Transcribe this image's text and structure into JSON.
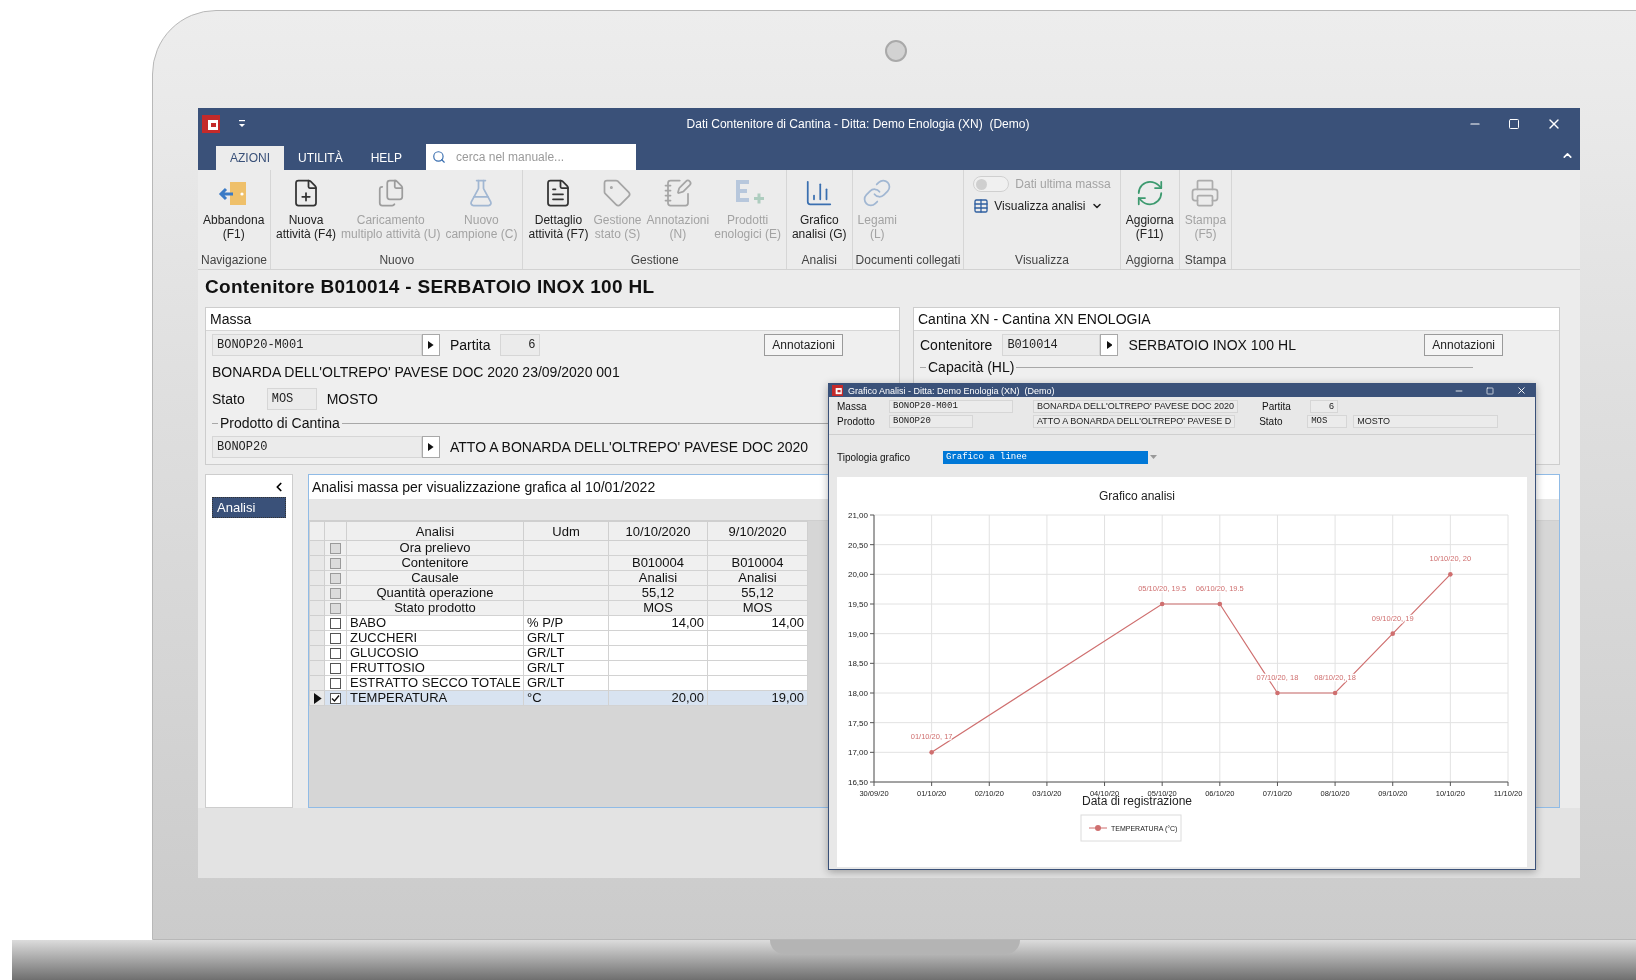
{
  "window": {
    "title": "Dati Contenitore di Cantina - Ditta: Demo Enologia (XN)  (Demo)"
  },
  "ribbon": {
    "tabs": [
      {
        "label": "AZIONI",
        "selected": true
      },
      {
        "label": "UTILITÀ",
        "selected": false
      },
      {
        "label": "HELP",
        "selected": false
      }
    ],
    "search": {
      "placeholder": "cerca nel manuale..."
    },
    "groups": [
      {
        "label": "Navigazione",
        "items": [
          {
            "kind": "large",
            "lines": [
              "Abbandona",
              "(F1)"
            ],
            "disabled": false
          }
        ]
      },
      {
        "label": "Nuovo",
        "items": [
          {
            "kind": "large",
            "lines": [
              "Nuova",
              "attività (F4)"
            ],
            "disabled": false
          },
          {
            "kind": "large",
            "lines": [
              "Caricamento",
              "multiplo attività (U)"
            ],
            "disabled": true
          },
          {
            "kind": "large",
            "lines": [
              "Nuovo",
              "campione (C)"
            ],
            "disabled": true
          }
        ]
      },
      {
        "label": "Gestione",
        "items": [
          {
            "kind": "large",
            "lines": [
              "Dettaglio",
              "attività (F7)"
            ],
            "disabled": false
          },
          {
            "kind": "large",
            "lines": [
              "Gestione",
              "stato (S)"
            ],
            "disabled": true
          },
          {
            "kind": "large",
            "lines": [
              "Annotazioni",
              "(N)"
            ],
            "disabled": true
          },
          {
            "kind": "large",
            "lines": [
              "Prodotti",
              "enologici (E)"
            ],
            "disabled": true
          }
        ]
      },
      {
        "label": "Analisi",
        "items": [
          {
            "kind": "large",
            "lines": [
              "Grafico",
              "analisi (G)"
            ],
            "disabled": false
          }
        ]
      },
      {
        "label": "Documenti collegati",
        "items": [
          {
            "kind": "large",
            "lines": [
              "Legami",
              "(L)"
            ],
            "disabled": true
          }
        ]
      },
      {
        "label": "Visualizza",
        "items": [
          {
            "kind": "toggle",
            "label": "Dati ultima massa",
            "on": false,
            "disabled": true
          },
          {
            "kind": "dropdown",
            "label": "Visualizza analisi",
            "disabled": false
          }
        ]
      },
      {
        "label": "Aggiorna",
        "items": [
          {
            "kind": "large",
            "lines": [
              "Aggiorna",
              "(F11)"
            ],
            "disabled": false
          }
        ]
      },
      {
        "label": "Stampa",
        "items": [
          {
            "kind": "large",
            "lines": [
              "Stampa",
              "(F5)"
            ],
            "disabled": true
          }
        ]
      }
    ]
  },
  "page_title": "Contenitore B010014 - SERBATOIO INOX 100 HL",
  "massa": {
    "title": "Massa",
    "code": "BONOP20-M001",
    "partita_label": "Partita",
    "partita": "6",
    "notes_button": "Annotazioni",
    "description": "BONARDA DELL'OLTREPO' PAVESE DOC 2020 23/09/2020 001",
    "stato_label": "Stato",
    "stato": "MOS",
    "stato_name": "MOSTO",
    "product_group": "Prodotto di Cantina",
    "product_code": "BONOP20",
    "product_name": "ATTO A BONARDA DELL'OLTREPO' PAVESE DOC 2020"
  },
  "cantina": {
    "title": "Cantina XN - Cantina XN ENOLOGIA",
    "container_label": "Contenitore",
    "container_code": "B010014",
    "container_name": "SERBATOIO INOX 100 HL",
    "notes_button": "Annotazioni",
    "capacity_group": "Capacità (HL)"
  },
  "sidebar": {
    "items": [
      {
        "label": "Analisi",
        "selected": true
      }
    ]
  },
  "analysis": {
    "title": "Analisi massa per visualizzazione grafica al 10/01/2022",
    "columns": [
      "Analisi",
      "Udm",
      "10/10/2020",
      "9/10/2020"
    ],
    "rows": [
      {
        "kind": "info",
        "label": "Ora prelievo",
        "checked": false,
        "selected": false
      },
      {
        "kind": "info",
        "label": "Contenitore",
        "values": [
          "B010004",
          "B010004"
        ],
        "checked": false,
        "selected": false
      },
      {
        "kind": "info",
        "label": "Causale",
        "values": [
          "Analisi",
          "Analisi"
        ],
        "checked": false,
        "selected": false
      },
      {
        "kind": "info",
        "label": "Quantità operazione",
        "values": [
          "55,12",
          "55,12"
        ],
        "checked": false,
        "selected": false
      },
      {
        "kind": "info",
        "label": "Stato prodotto",
        "values": [
          "MOS",
          "MOS"
        ],
        "checked": false,
        "selected": false
      },
      {
        "kind": "analysis",
        "label": "BABO",
        "udm": "% P/P",
        "values": [
          "14,00",
          "14,00"
        ],
        "checked": false,
        "selected": false
      },
      {
        "kind": "analysis",
        "label": "ZUCCHERI",
        "udm": "GR/LT",
        "checked": false,
        "selected": false
      },
      {
        "kind": "analysis",
        "label": "GLUCOSIO",
        "udm": "GR/LT",
        "checked": false,
        "selected": false
      },
      {
        "kind": "analysis",
        "label": "FRUTTOSIO",
        "udm": "GR/LT",
        "checked": false,
        "selected": false
      },
      {
        "kind": "analysis",
        "label": "ESTRATTO SECCO TOTALE",
        "udm": "GR/LT",
        "checked": false,
        "selected": false
      },
      {
        "kind": "analysis",
        "label": "TEMPERATURA",
        "udm": "°C",
        "values": [
          "20,00",
          "19,00"
        ],
        "checked": true,
        "selected": true
      }
    ]
  },
  "chart_dialog": {
    "title": "Grafico Analisi - Ditta: Demo Enologia (XN)  (Demo)",
    "massa_label": "Massa",
    "massa_code": "BONOP20-M001",
    "massa_name": "BONARDA DELL'OLTREPO' PAVESE DOC 2020",
    "partita_label": "Partita",
    "partita": "6",
    "prodotto_label": "Prodotto",
    "prodotto_code": "BONOP20",
    "prodotto_name": "ATTO A BONARDA DELL'OLTREPO' PAVESE D",
    "stato_label": "Stato",
    "stato": "MOS",
    "stato_name": "MOSTO",
    "chart_type_label": "Tipologia grafico",
    "chart_type": "Grafico a linee",
    "chart_data": {
      "type": "line",
      "title": "Grafico analisi",
      "xlabel": "Data di registrazione",
      "categories": [
        "30/09/20",
        "01/10/20",
        "02/10/20",
        "03/10/20",
        "04/10/20",
        "05/10/20",
        "06/10/20",
        "07/10/20",
        "08/10/20",
        "09/10/20",
        "10/10/20",
        "11/10/20"
      ],
      "series": [
        {
          "name": "TEMPERATURA (°C)",
          "color": "#cf6f6f",
          "values": [
            null,
            17,
            null,
            null,
            null,
            19.5,
            19.5,
            18,
            18,
            19,
            20,
            null
          ]
        }
      ],
      "ylim": [
        16.5,
        21
      ],
      "grid": true,
      "yticks": [
        {
          "value": 16.5,
          "label": "16,50"
        },
        {
          "value": 17,
          "label": "17,00"
        },
        {
          "value": 17.5,
          "label": "17,50"
        },
        {
          "value": 18,
          "label": "18,00"
        },
        {
          "value": 18.5,
          "label": "18,50"
        },
        {
          "value": 19,
          "label": "19,00"
        },
        {
          "value": 19.5,
          "label": "19,50"
        },
        {
          "value": 20,
          "label": "20,00"
        },
        {
          "value": 20.5,
          "label": "20,50"
        },
        {
          "value": 21,
          "label": "21,00"
        }
      ],
      "value_labels": [
        null,
        "01/10/20, 17",
        null,
        null,
        null,
        "05/10/20, 19.5",
        "06/10/20, 19.5",
        "07/10/20, 18",
        "08/10/20, 18",
        "09/10/20, 19",
        "10/10/20, 20",
        null
      ]
    }
  }
}
